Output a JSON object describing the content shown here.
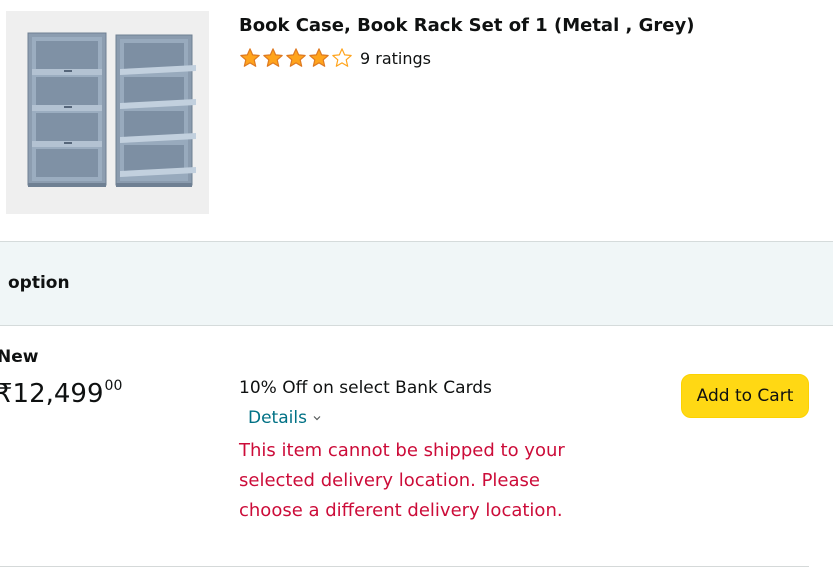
{
  "product": {
    "title": "Book Case, Book Rack Set of 1 (Metal , Grey)",
    "rating_out_of_5": 4,
    "rating_count_label": "9 ratings",
    "star_color": "#ffa41c",
    "image_icon": "metal-bookcase-image"
  },
  "section": {
    "label": "option"
  },
  "offer": {
    "condition": "New",
    "price_whole": "₹12,499",
    "price_fraction": "00",
    "promo_text": "10% Off on select Bank Cards",
    "details_label": "Details",
    "details_icon": "chevron-down-icon",
    "warning_text": "This item cannot be shipped to your selected delivery location. Please choose a different delivery location.",
    "warning_color": "#cc0c39",
    "add_to_cart_label": "Add to Cart",
    "button_color": "#ffd814"
  }
}
